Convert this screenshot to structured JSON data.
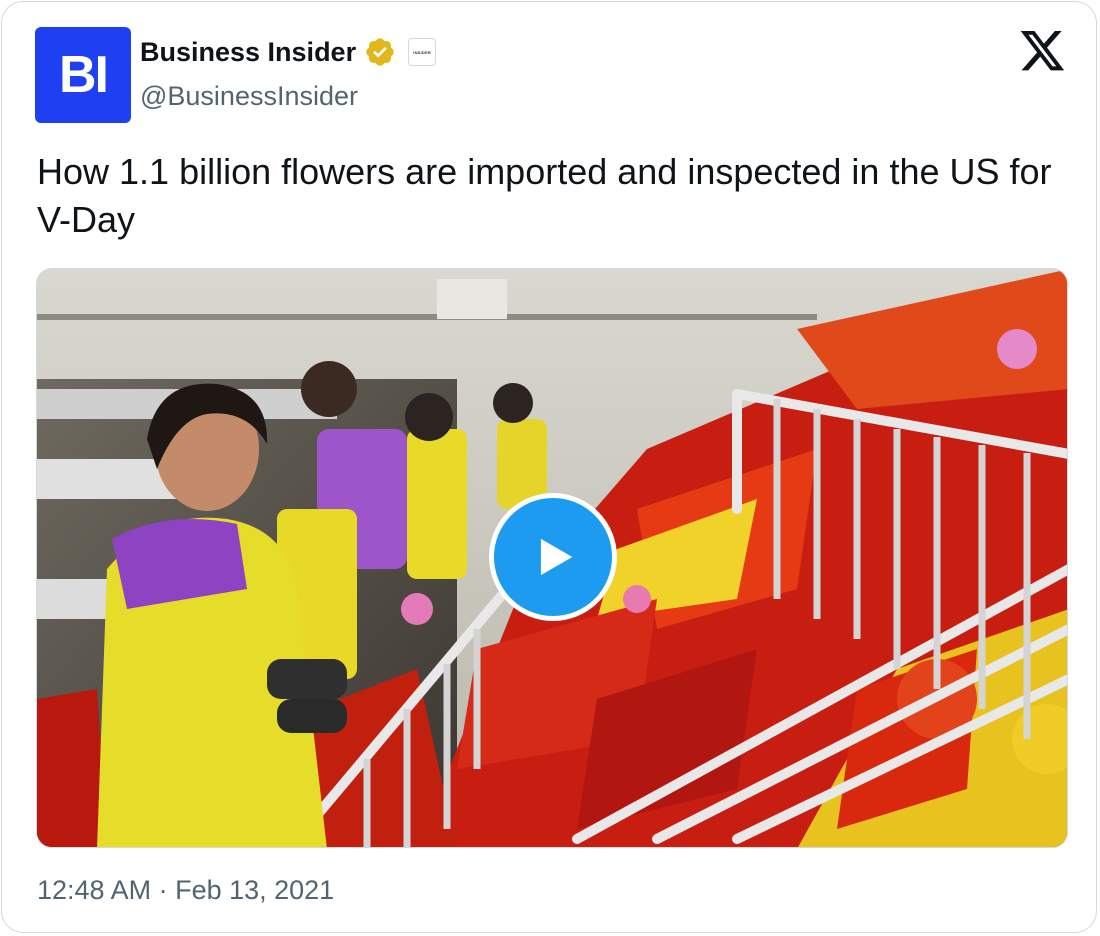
{
  "account": {
    "avatar_text": "BI",
    "display_name": "Business Insider",
    "handle": "@BusinessInsider",
    "affiliate_badge_text": "INSIDER",
    "brand_color": "#1f3ff2"
  },
  "tweet": {
    "text": "How 1.1 billion flowers are imported and inspected in the US for V-Day",
    "timestamp": "12:48 AM · Feb 13, 2021"
  },
  "media": {
    "type": "video",
    "play_icon": "play-icon",
    "accent": "#1d9bf0"
  },
  "icons": {
    "verified": "verified-badge-icon",
    "platform": "x-logo-icon"
  }
}
